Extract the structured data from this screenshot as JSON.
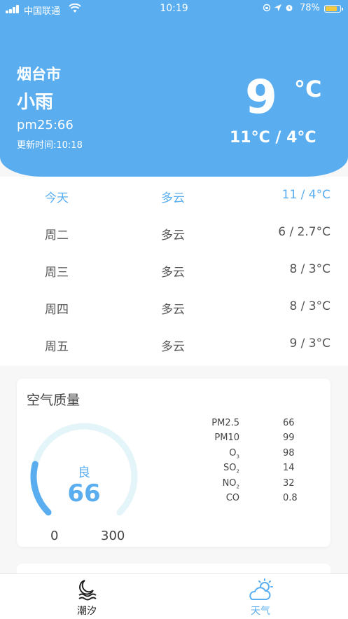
{
  "status_bar": {
    "carrier": "中国联通",
    "time": "10:19",
    "battery_percent": "78%",
    "battery_level": 0.78
  },
  "header": {
    "city": "烟台市",
    "condition": "小雨",
    "pm": "pm25:66",
    "update_time": "更新时间:10:18",
    "temperature": "9",
    "unit": "°C",
    "range": "11°C / 4°C"
  },
  "forecast": [
    {
      "day": "今天",
      "condition": "多云",
      "temp": "11 / 4°C"
    },
    {
      "day": "周二",
      "condition": "多云",
      "temp": "6 / 2.7°C"
    },
    {
      "day": "周三",
      "condition": "多云",
      "temp": "8 / 3°C"
    },
    {
      "day": "周四",
      "condition": "多云",
      "temp": "8 / 3°C"
    },
    {
      "day": "周五",
      "condition": "多云",
      "temp": "9 / 3°C"
    }
  ],
  "air_quality": {
    "title": "空气质量",
    "level": "良",
    "value": "66",
    "gauge_min": "0",
    "gauge_max": "300",
    "gauge_value": 66,
    "pollutants": [
      {
        "name": "PM2.5",
        "sub": "",
        "value": "66"
      },
      {
        "name": "PM10",
        "sub": "",
        "value": "99"
      },
      {
        "name": "O",
        "sub": "3",
        "value": "98"
      },
      {
        "name": "SO",
        "sub": "2",
        "value": "14"
      },
      {
        "name": "NO",
        "sub": "2",
        "value": "32"
      },
      {
        "name": "CO",
        "sub": "",
        "value": "0.8"
      }
    ]
  },
  "tabs": [
    {
      "label": "潮汐",
      "icon": "moon-waves-icon"
    },
    {
      "label": "天气",
      "icon": "sun-cloud-icon"
    }
  ],
  "colors": {
    "accent": "#5aaef0",
    "gauge_track": "#e3f5f8"
  }
}
